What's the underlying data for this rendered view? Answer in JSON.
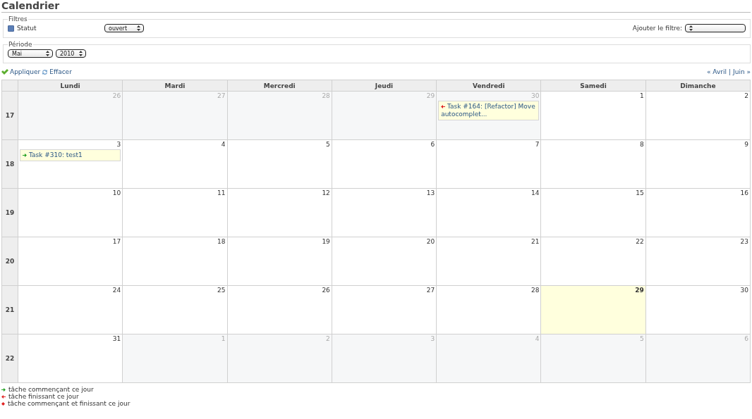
{
  "title": "Calendrier",
  "filters": {
    "legend": "Filtres",
    "status": {
      "label": "Statut",
      "checked": true,
      "value": "ouvert"
    },
    "add_filter": {
      "label": "Ajouter le filtre:"
    }
  },
  "period": {
    "legend": "Période",
    "month": "Mai",
    "year": "2010"
  },
  "actions": {
    "apply": "Appliquer",
    "clear": "Effacer"
  },
  "nav": {
    "prev": "« Avril",
    "separator": "|",
    "next": "Juin »"
  },
  "columns": [
    "Lundi",
    "Mardi",
    "Mercredi",
    "Jeudi",
    "Vendredi",
    "Samedi",
    "Dimanche"
  ],
  "weeks": [
    {
      "number": "17",
      "days": [
        {
          "day": "26",
          "other_month": true,
          "today": false
        },
        {
          "day": "27",
          "other_month": true,
          "today": false
        },
        {
          "day": "28",
          "other_month": true,
          "today": false
        },
        {
          "day": "29",
          "other_month": true,
          "today": false
        },
        {
          "day": "30",
          "other_month": true,
          "today": false,
          "tasks": [
            {
              "kind": "end",
              "text": "Task #164: [Refactor] Move autocomplet..."
            }
          ]
        },
        {
          "day": "1",
          "other_month": false,
          "today": false
        },
        {
          "day": "2",
          "other_month": false,
          "today": false
        }
      ]
    },
    {
      "number": "18",
      "days": [
        {
          "day": "3",
          "other_month": false,
          "today": false,
          "tasks": [
            {
              "kind": "start",
              "text": "Task #310: test1"
            }
          ]
        },
        {
          "day": "4",
          "other_month": false,
          "today": false
        },
        {
          "day": "5",
          "other_month": false,
          "today": false
        },
        {
          "day": "6",
          "other_month": false,
          "today": false
        },
        {
          "day": "7",
          "other_month": false,
          "today": false
        },
        {
          "day": "8",
          "other_month": false,
          "today": false
        },
        {
          "day": "9",
          "other_month": false,
          "today": false
        }
      ]
    },
    {
      "number": "19",
      "days": [
        {
          "day": "10",
          "other_month": false,
          "today": false
        },
        {
          "day": "11",
          "other_month": false,
          "today": false
        },
        {
          "day": "12",
          "other_month": false,
          "today": false
        },
        {
          "day": "13",
          "other_month": false,
          "today": false
        },
        {
          "day": "14",
          "other_month": false,
          "today": false
        },
        {
          "day": "15",
          "other_month": false,
          "today": false
        },
        {
          "day": "16",
          "other_month": false,
          "today": false
        }
      ]
    },
    {
      "number": "20",
      "days": [
        {
          "day": "17",
          "other_month": false,
          "today": false
        },
        {
          "day": "18",
          "other_month": false,
          "today": false
        },
        {
          "day": "19",
          "other_month": false,
          "today": false
        },
        {
          "day": "20",
          "other_month": false,
          "today": false
        },
        {
          "day": "21",
          "other_month": false,
          "today": false
        },
        {
          "day": "22",
          "other_month": false,
          "today": false
        },
        {
          "day": "23",
          "other_month": false,
          "today": false
        }
      ]
    },
    {
      "number": "21",
      "days": [
        {
          "day": "24",
          "other_month": false,
          "today": false
        },
        {
          "day": "25",
          "other_month": false,
          "today": false
        },
        {
          "day": "26",
          "other_month": false,
          "today": false
        },
        {
          "day": "27",
          "other_month": false,
          "today": false
        },
        {
          "day": "28",
          "other_month": false,
          "today": false
        },
        {
          "day": "29",
          "other_month": false,
          "today": true
        },
        {
          "day": "30",
          "other_month": false,
          "today": false
        }
      ]
    },
    {
      "number": "22",
      "days": [
        {
          "day": "31",
          "other_month": false,
          "today": false
        },
        {
          "day": "1",
          "other_month": true,
          "today": false
        },
        {
          "day": "2",
          "other_month": true,
          "today": false
        },
        {
          "day": "3",
          "other_month": true,
          "today": false
        },
        {
          "day": "4",
          "other_month": true,
          "today": false
        },
        {
          "day": "5",
          "other_month": true,
          "today": false
        },
        {
          "day": "6",
          "other_month": true,
          "today": false
        }
      ]
    }
  ],
  "legend": [
    {
      "kind": "start",
      "text": "tâche commençant ce jour"
    },
    {
      "kind": "end",
      "text": "tâche finissant ce jour"
    },
    {
      "kind": "both",
      "text": "tâche commençant et finissant ce jour"
    }
  ]
}
